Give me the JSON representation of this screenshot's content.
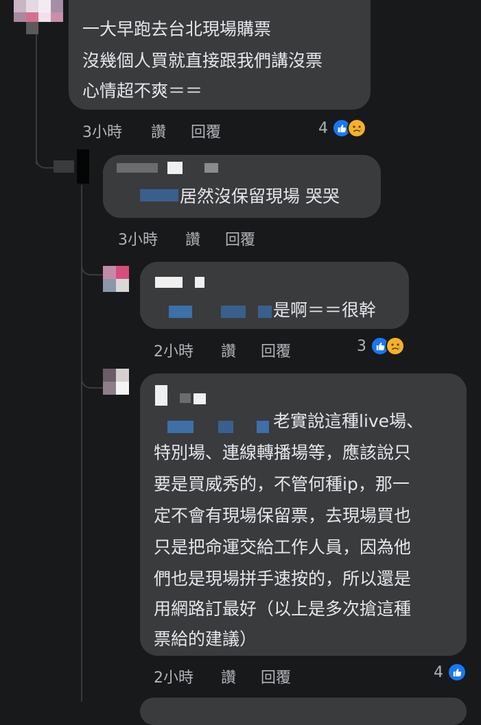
{
  "comments": [
    {
      "id": "c1",
      "lines": [
        "一大早跑去台北現場購票",
        "沒幾個人買就直接跟我們講沒票",
        "心情超不爽＝＝"
      ],
      "time": "3小時",
      "like": "讚",
      "reply": "回覆",
      "reaction_count": "4",
      "reactions": [
        "like-icon",
        "sad-icon"
      ]
    },
    {
      "id": "c2",
      "lines": [
        "居然沒保留現場 哭哭"
      ],
      "time": "3小時",
      "like": "讚",
      "reply": "回覆"
    },
    {
      "id": "c3",
      "lines": [
        "是啊＝＝很幹"
      ],
      "time": "2小時",
      "like": "讚",
      "reply": "回覆",
      "reaction_count": "3",
      "reactions": [
        "like-icon",
        "sad-icon"
      ]
    },
    {
      "id": "c4",
      "lines": [
        "老實說這種live場、",
        "特別場、連線轉播場等，應該說只",
        "要是買威秀的，不管何種ip，那一",
        "定不會有現場保留票，去現場買也",
        "只是把命運交給工作人員，因為他",
        "們也是現場拼手速按的，所以還是",
        "用網路訂最好（以上是多次搶這種",
        "票給的建議）"
      ],
      "time": "2小時",
      "like": "讚",
      "reply": "回覆",
      "reaction_count": "4",
      "reactions": [
        "like-icon"
      ]
    }
  ],
  "colors": {
    "background": "#18191a",
    "bubble": "#3a3b3c",
    "text": "#e4e6eb",
    "meta": "#b0b3b8",
    "like_blue": "#1877f2",
    "sad_yellow": "#f7b125"
  }
}
